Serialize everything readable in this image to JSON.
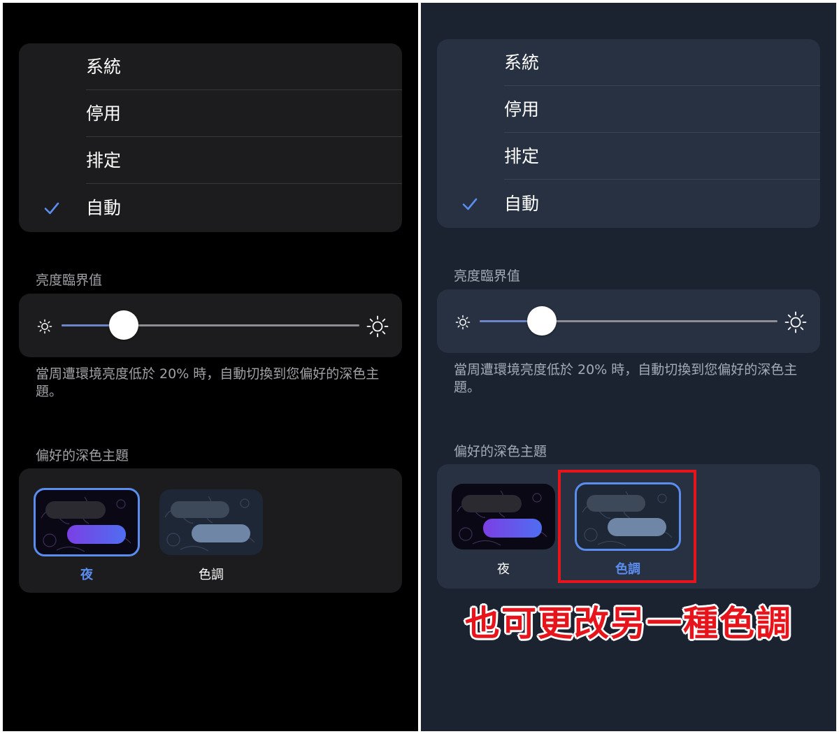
{
  "panels": {
    "left": {
      "menu": [
        {
          "label": "系統",
          "checked": false
        },
        {
          "label": "停用",
          "checked": false
        },
        {
          "label": "排定",
          "checked": false
        },
        {
          "label": "自動",
          "checked": true
        }
      ],
      "brightness_label": "亮度臨界值",
      "slider_value_fraction": 0.21,
      "footnote": "當周遭環境亮度低於 20% 時，自動切換到您偏好的深色主題。",
      "theme_section_label": "偏好的深色主題",
      "themes": [
        {
          "label": "夜",
          "selected": true
        },
        {
          "label": "色調",
          "selected": false
        }
      ]
    },
    "right": {
      "menu": [
        {
          "label": "系統",
          "checked": false
        },
        {
          "label": "停用",
          "checked": false
        },
        {
          "label": "排定",
          "checked": false
        },
        {
          "label": "自動",
          "checked": true
        }
      ],
      "brightness_label": "亮度臨界值",
      "slider_value_fraction": 0.21,
      "footnote": "當周遭環境亮度低於 20% 時，自動切換到您偏好的深色主題。",
      "theme_section_label": "偏好的深色主題",
      "themes": [
        {
          "label": "夜",
          "selected": false
        },
        {
          "label": "色調",
          "selected": true
        }
      ]
    }
  },
  "annotation": "也可更改另一種色調",
  "colors": {
    "accent": "#5b8def",
    "annotation_red": "#e8141c",
    "left_background": "#000000",
    "right_background": "#1b2230"
  },
  "icons": [
    "checkmark-icon",
    "sun-small-icon",
    "sun-large-icon"
  ]
}
